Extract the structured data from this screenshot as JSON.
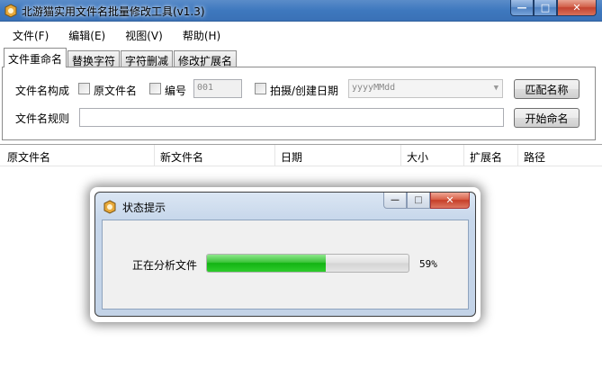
{
  "window": {
    "title": "北游猫实用文件名批量修改工具(v1.3)",
    "controls": {
      "minimize": "—",
      "maximize": "□",
      "close": "✕"
    }
  },
  "menu": [
    "文件(F)",
    "编辑(E)",
    "视图(V)",
    "帮助(H)"
  ],
  "tabs": [
    "文件重命名",
    "替换字符",
    "字符删减",
    "修改扩展名"
  ],
  "form": {
    "composition_label": "文件名构成",
    "original_name_label": "原文件名",
    "number_label": "编号",
    "number_value": "001",
    "date_label": "拍摄/创建日期",
    "date_format": "yyyyMMdd",
    "match_button": "匹配名称",
    "rule_label": "文件名规则",
    "rule_value": "",
    "start_button": "开始命名"
  },
  "list": {
    "columns": [
      "原文件名",
      "新文件名",
      "日期",
      "大小",
      "扩展名",
      "路径"
    ]
  },
  "dialog": {
    "title": "状态提示",
    "status_label": "正在分析文件",
    "progress_percent": 59,
    "progress_text": "59%"
  },
  "colors": {
    "titlebar": "#3e78be",
    "progress_fill": "#13b413",
    "dialog_close": "#c63e28"
  }
}
